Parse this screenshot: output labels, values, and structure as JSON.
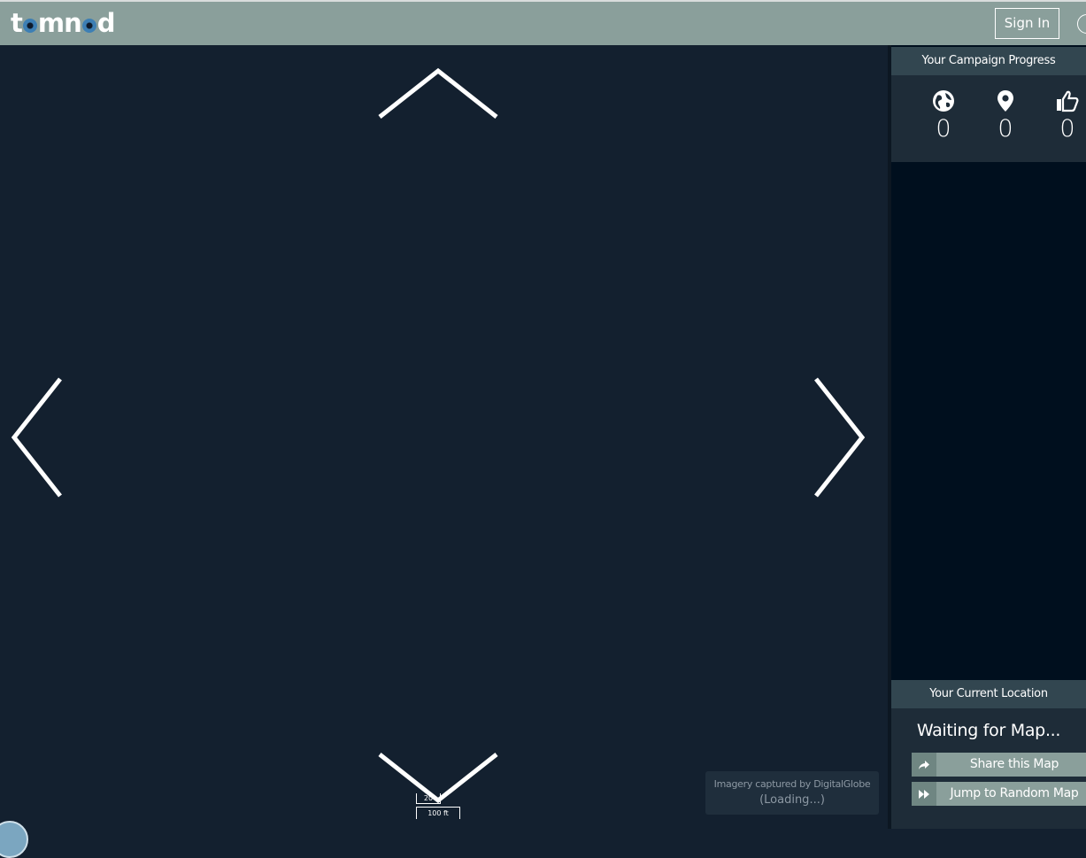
{
  "header": {
    "logo_text_before": "t",
    "logo_text_middle": "mn",
    "logo_text_after": "d",
    "signin_label": "Sign In"
  },
  "map": {
    "attribution_line1": "Imagery captured by DigitalGlobe",
    "attribution_line2": "(Loading...)",
    "scale_small": "20",
    "scale_large": "100 ft"
  },
  "sidebar": {
    "progress": {
      "title": "Your Campaign Progress",
      "stats": [
        {
          "icon": "globe-icon",
          "value": "0"
        },
        {
          "icon": "map-pin-icon",
          "value": "0"
        },
        {
          "icon": "thumbs-up-icon",
          "value": "0"
        }
      ]
    },
    "location": {
      "title": "Your Current Location",
      "status": "Waiting for Map...",
      "share_label": "Share this Map",
      "jump_label": "Jump to Random Map"
    }
  },
  "colors": {
    "header_bg": "#8a9f9b",
    "map_bg": "#13202f",
    "sidebar_bg": "#000f1e",
    "panel_header_bg": "#324650",
    "panel_bg": "#1e2c38"
  }
}
